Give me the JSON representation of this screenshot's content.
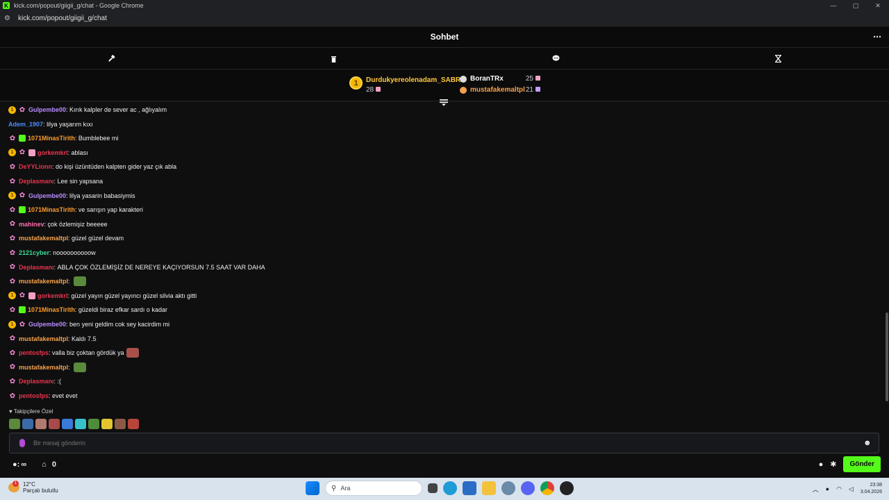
{
  "window": {
    "title": "kick.com/popout/giigii_g/chat - Google Chrome",
    "url": "kick.com/popout/giigii_g/chat"
  },
  "header": {
    "title": "Sohbet",
    "menu_icon": "more-icon"
  },
  "toolbar": [
    "hammer-icon",
    "trash-icon",
    "chat-bubble-icon",
    "hourglass-icon"
  ],
  "leaderboard": {
    "first": {
      "rank": "1",
      "name": "Durdukyereolenadam_SABRI",
      "count": "28"
    },
    "others": [
      {
        "name": "BoranTRx",
        "count": "25",
        "color": "#ffffff",
        "icon_color": "#dddddd"
      },
      {
        "name": "mustafakemaltpl",
        "count": "21",
        "color": "#f7a24b",
        "icon_color": "#f0a050"
      }
    ]
  },
  "messages": [
    {
      "badges": [
        "gold",
        "bfly"
      ],
      "user": "Gulpembe00",
      "color": "#b98cff",
      "text": "Kırık kalpler de sever ac , ağlıyalım"
    },
    {
      "badges": [],
      "user": "Adem_1907",
      "color": "#4a8cff",
      "text": "lilya yaşarım kıxı"
    },
    {
      "badges": [
        "bfly",
        "gift-g"
      ],
      "user": "1071MinasTirith",
      "color": "#ff9c2a",
      "text": "Bumblebee mi"
    },
    {
      "badges": [
        "gold",
        "bfly",
        "gift-p"
      ],
      "user": "gorkemkrl",
      "color": "#e8364f",
      "text": "ablası"
    },
    {
      "badges": [
        "bfly"
      ],
      "user": "DeYYLionn",
      "color": "#e8364f",
      "text": "do kişi üzüntüden kalpten gider yaz çık abla"
    },
    {
      "badges": [
        "bfly"
      ],
      "user": "Deplasmanı",
      "color": "#e8364f",
      "text": "Lee sin yapsana"
    },
    {
      "badges": [
        "gold",
        "bfly"
      ],
      "user": "Gulpembe00",
      "color": "#b98cff",
      "text": "lilya yasarin babasiymis"
    },
    {
      "badges": [
        "bfly",
        "gift-g"
      ],
      "user": "1071MinasTirith",
      "color": "#ff9c2a",
      "text": "ve sarışın yap karakteri"
    },
    {
      "badges": [
        "bfly"
      ],
      "user": "mahinev",
      "color": "#ff6fb0",
      "text": "çok özlemişiz beeeee"
    },
    {
      "badges": [
        "bfly"
      ],
      "user": "mustafakemaltpl",
      "color": "#f7a24b",
      "text": "güzel güzel devam"
    },
    {
      "badges": [
        "bfly"
      ],
      "user": "2121cyber",
      "color": "#3ddc97",
      "text": "noooooooooow"
    },
    {
      "badges": [
        "bfly"
      ],
      "user": "Deplasmanı",
      "color": "#e8364f",
      "text": "ABLA ÇOK ÖZLEMİŞİZ DE NEREYE KAÇIYORSUN 7.5 SAAT VAR DAHA"
    },
    {
      "badges": [
        "bfly"
      ],
      "user": "mustafakemaltpl",
      "color": "#f7a24b",
      "text": "",
      "emote": "frog"
    },
    {
      "badges": [
        "gold",
        "bfly",
        "gift-p"
      ],
      "user": "gorkemkrl",
      "color": "#e8364f",
      "text": "güzel yayın güzel yayıncı güzel silvia aktı gitti"
    },
    {
      "badges": [
        "bfly",
        "gift-g"
      ],
      "user": "1071MinasTirith",
      "color": "#ff9c2a",
      "text": "güzeldi biraz efkar sardı o kadar"
    },
    {
      "badges": [
        "gold",
        "bfly"
      ],
      "user": "Gulpembe00",
      "color": "#b98cff",
      "text": "ben yeni geldim cok sey kacirdim mi"
    },
    {
      "badges": [
        "bfly"
      ],
      "user": "mustafakemaltpl",
      "color": "#f7a24b",
      "text": "Kaldı 7.5"
    },
    {
      "badges": [
        "bfly"
      ],
      "user": "pentosfps",
      "color": "#e8364f",
      "text": "valla biz çoktan gördük ya",
      "emote": "face"
    },
    {
      "badges": [
        "bfly"
      ],
      "user": "mustafakemaltpl",
      "color": "#f7a24b",
      "text": "",
      "emote": "frog"
    },
    {
      "badges": [
        "bfly"
      ],
      "user": "Deplasmanı",
      "color": "#e8364f",
      "text": ":("
    },
    {
      "badges": [
        "bfly"
      ],
      "user": "pentosfps",
      "color": "#e8364f",
      "text": "evet evet"
    }
  ],
  "followers_label": "Takipçilere Özel",
  "input": {
    "placeholder": "Bir mesaj gönderin"
  },
  "bottom": {
    "points": "∞",
    "shop_count": "0",
    "send_label": "Gönder"
  },
  "taskbar": {
    "weather_temp": "12°C",
    "weather_desc": "Parçalı bulutlu",
    "search_placeholder": "Ara",
    "time": "23:38",
    "date": "3.04.2026"
  }
}
